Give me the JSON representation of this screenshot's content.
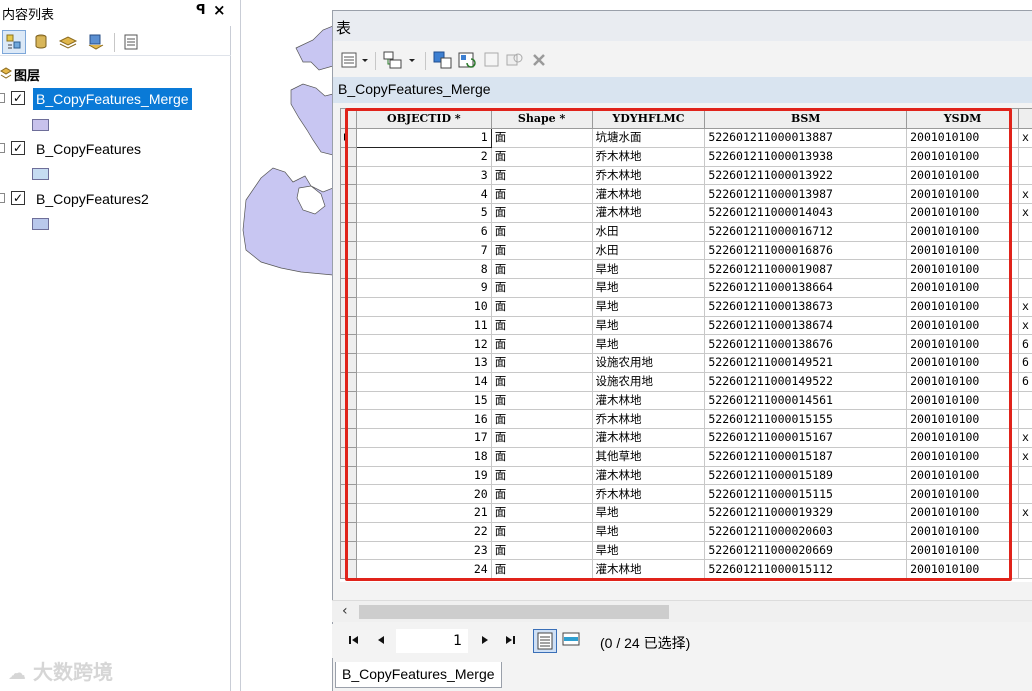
{
  "toc": {
    "title": "内容列表",
    "pin_glyph": "ꟼ",
    "close_glyph": "×",
    "root_label": "图层",
    "layers": [
      {
        "name": "B_CopyFeatures_Merge",
        "checked": true,
        "selected": true,
        "swatch": "#c8c2ec"
      },
      {
        "name": "B_CopyFeatures",
        "checked": true,
        "selected": false,
        "swatch": "#c6dcf2"
      },
      {
        "name": "B_CopyFeatures2",
        "checked": true,
        "selected": false,
        "swatch": "#b9c8ec"
      }
    ]
  },
  "map": {
    "polygon_color": "#c8c6f2"
  },
  "table_window": {
    "title": "表",
    "table_name": "B_CopyFeatures_Merge",
    "columns": [
      {
        "label": "OBJECTID",
        "star": "*"
      },
      {
        "label": "Shape",
        "star": "*"
      },
      {
        "label": "YDYHFLMC",
        "star": ""
      },
      {
        "label": "BSM",
        "star": ""
      },
      {
        "label": "YSDM",
        "star": ""
      }
    ],
    "rows": [
      {
        "id": "1",
        "shape": "面",
        "ydyhflmc": "坑塘水面",
        "bsm": "522601211000013887",
        "ysdm": "2001010100",
        "extra": "x"
      },
      {
        "id": "2",
        "shape": "面",
        "ydyhflmc": "乔木林地",
        "bsm": "522601211000013938",
        "ysdm": "2001010100",
        "extra": ""
      },
      {
        "id": "3",
        "shape": "面",
        "ydyhflmc": "乔木林地",
        "bsm": "522601211000013922",
        "ysdm": "2001010100",
        "extra": ""
      },
      {
        "id": "4",
        "shape": "面",
        "ydyhflmc": "灌木林地",
        "bsm": "522601211000013987",
        "ysdm": "2001010100",
        "extra": "x"
      },
      {
        "id": "5",
        "shape": "面",
        "ydyhflmc": "灌木林地",
        "bsm": "522601211000014043",
        "ysdm": "2001010100",
        "extra": "x"
      },
      {
        "id": "6",
        "shape": "面",
        "ydyhflmc": "水田",
        "bsm": "522601211000016712",
        "ysdm": "2001010100",
        "extra": ""
      },
      {
        "id": "7",
        "shape": "面",
        "ydyhflmc": "水田",
        "bsm": "522601211000016876",
        "ysdm": "2001010100",
        "extra": ""
      },
      {
        "id": "8",
        "shape": "面",
        "ydyhflmc": "旱地",
        "bsm": "522601211000019087",
        "ysdm": "2001010100",
        "extra": ""
      },
      {
        "id": "9",
        "shape": "面",
        "ydyhflmc": "旱地",
        "bsm": "522601211000138664",
        "ysdm": "2001010100",
        "extra": ""
      },
      {
        "id": "10",
        "shape": "面",
        "ydyhflmc": "旱地",
        "bsm": "522601211000138673",
        "ysdm": "2001010100",
        "extra": "x"
      },
      {
        "id": "11",
        "shape": "面",
        "ydyhflmc": "旱地",
        "bsm": "522601211000138674",
        "ysdm": "2001010100",
        "extra": "x"
      },
      {
        "id": "12",
        "shape": "面",
        "ydyhflmc": "旱地",
        "bsm": "522601211000138676",
        "ysdm": "2001010100",
        "extra": "6"
      },
      {
        "id": "13",
        "shape": "面",
        "ydyhflmc": "设施农用地",
        "bsm": "522601211000149521",
        "ysdm": "2001010100",
        "extra": "6"
      },
      {
        "id": "14",
        "shape": "面",
        "ydyhflmc": "设施农用地",
        "bsm": "522601211000149522",
        "ysdm": "2001010100",
        "extra": "6"
      },
      {
        "id": "15",
        "shape": "面",
        "ydyhflmc": "灌木林地",
        "bsm": "522601211000014561",
        "ysdm": "2001010100",
        "extra": ""
      },
      {
        "id": "16",
        "shape": "面",
        "ydyhflmc": "乔木林地",
        "bsm": "522601211000015155",
        "ysdm": "2001010100",
        "extra": ""
      },
      {
        "id": "17",
        "shape": "面",
        "ydyhflmc": "灌木林地",
        "bsm": "522601211000015167",
        "ysdm": "2001010100",
        "extra": "x"
      },
      {
        "id": "18",
        "shape": "面",
        "ydyhflmc": "其他草地",
        "bsm": "522601211000015187",
        "ysdm": "2001010100",
        "extra": "x"
      },
      {
        "id": "19",
        "shape": "面",
        "ydyhflmc": "灌木林地",
        "bsm": "522601211000015189",
        "ysdm": "2001010100",
        "extra": ""
      },
      {
        "id": "20",
        "shape": "面",
        "ydyhflmc": "乔木林地",
        "bsm": "522601211000015115",
        "ysdm": "2001010100",
        "extra": ""
      },
      {
        "id": "21",
        "shape": "面",
        "ydyhflmc": "旱地",
        "bsm": "522601211000019329",
        "ysdm": "2001010100",
        "extra": "x"
      },
      {
        "id": "22",
        "shape": "面",
        "ydyhflmc": "旱地",
        "bsm": "522601211000020603",
        "ysdm": "2001010100",
        "extra": ""
      },
      {
        "id": "23",
        "shape": "面",
        "ydyhflmc": "旱地",
        "bsm": "522601211000020669",
        "ysdm": "2001010100",
        "extra": ""
      },
      {
        "id": "24",
        "shape": "面",
        "ydyhflmc": "灌木林地",
        "bsm": "522601211000015112",
        "ysdm": "2001010100",
        "extra": ""
      }
    ],
    "highlight_color": "#e0231a"
  },
  "nav": {
    "first": "K",
    "prev": "◂",
    "current_record": "1",
    "next": "▸",
    "last": "▸I",
    "selection_info": "(0 / 24 已选择)"
  },
  "bottom_tab": {
    "label": "B_CopyFeatures_Merge"
  },
  "watermark": "大数跨境"
}
